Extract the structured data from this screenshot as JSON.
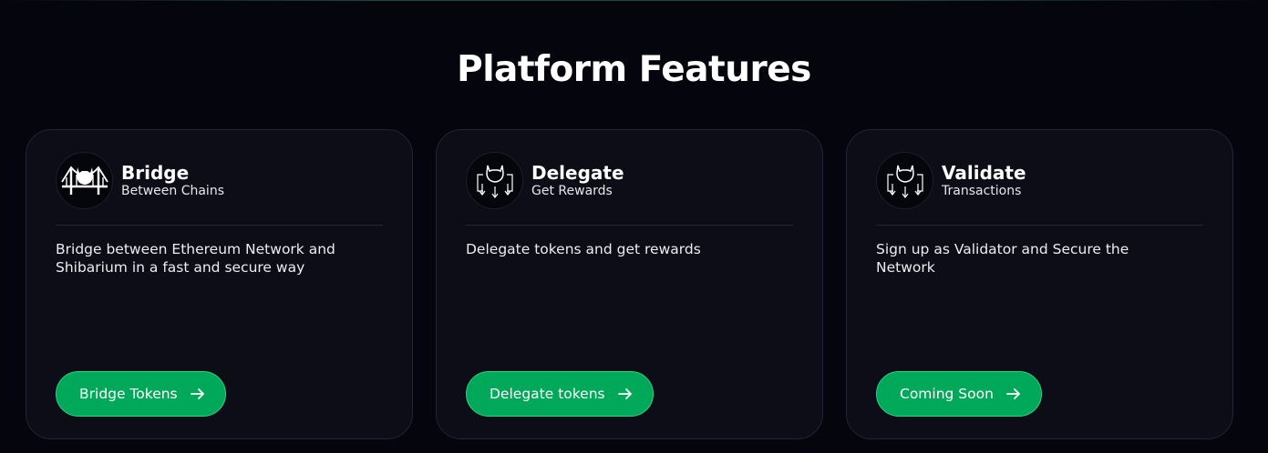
{
  "section": {
    "title": "Platform Features"
  },
  "colors": {
    "background": "#05050e",
    "card": "#0d0d17",
    "accent": "#00a85a"
  },
  "cards": [
    {
      "title": "Bridge",
      "subtitle": "Between Chains",
      "description": "Bridge between Ethereum Network and Shibarium in a fast and secure way",
      "cta_label": "Bridge Tokens",
      "icon": "bridge-icon"
    },
    {
      "title": "Delegate",
      "subtitle": "Get Rewards",
      "description": "Delegate tokens and get rewards",
      "cta_label": "Delegate tokens",
      "icon": "delegate-icon"
    },
    {
      "title": "Validate",
      "subtitle": "Transactions",
      "description": "Sign up as Validator and Secure the Network",
      "cta_label": "Coming Soon",
      "icon": "validate-icon"
    }
  ]
}
